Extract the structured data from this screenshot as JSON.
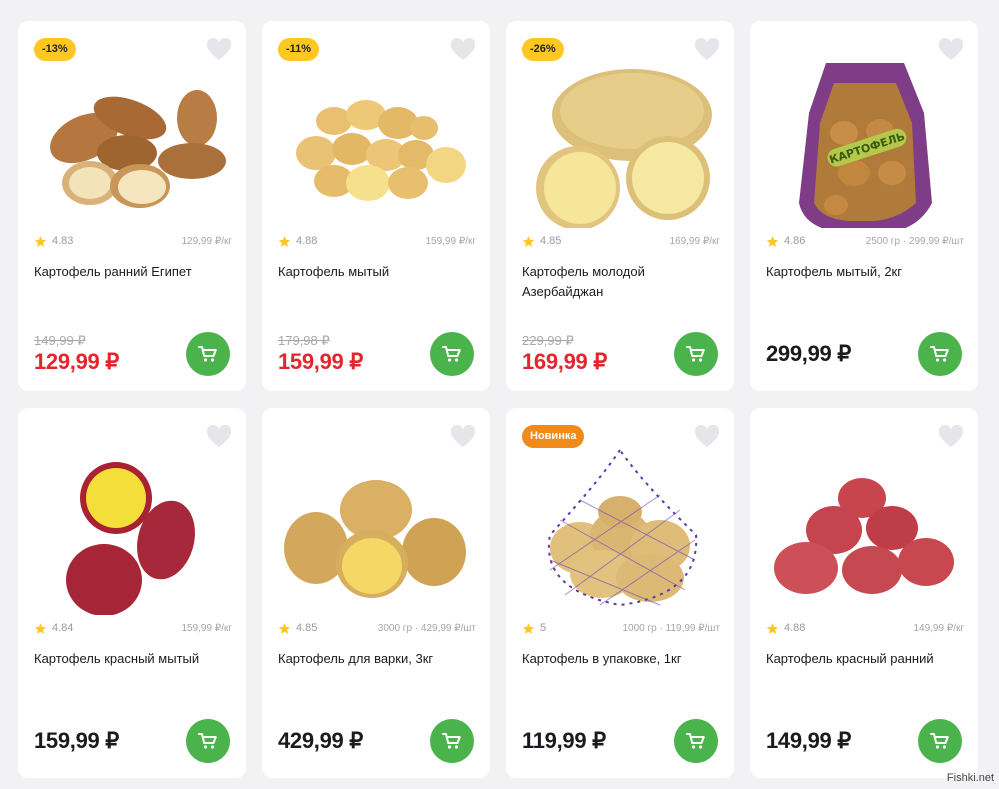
{
  "accent_color": "#4bb34b",
  "sale_color": "#e3262c",
  "badge_discount_color": "#ffc821",
  "badge_new_color": "#f08a1a",
  "products": [
    {
      "badge": "-13%",
      "badge_type": "discount",
      "rating": "4.83",
      "per_unit": "129,99 ₽/кг",
      "name": "Картофель ранний Египет",
      "old_price": "149,99 ₽",
      "price": "129,99 ₽",
      "image": "early-potatoes-egypt"
    },
    {
      "badge": "-11%",
      "badge_type": "discount",
      "rating": "4.88",
      "per_unit": "159,99 ₽/кг",
      "name": "Картофель мытый",
      "old_price": "179,98 ₽",
      "price": "159,99 ₽",
      "image": "washed-potatoes"
    },
    {
      "badge": "-26%",
      "badge_type": "discount",
      "rating": "4.85",
      "per_unit": "169,99 ₽/кг",
      "name": "Картофель молодой Азербайджан",
      "old_price": "229,99 ₽",
      "price": "169,99 ₽",
      "image": "young-potatoes"
    },
    {
      "badge": "",
      "badge_type": "",
      "rating": "4.86",
      "per_unit": "2500 гр · 299,99 ₽/шт",
      "name": "Картофель мытый, 2кг",
      "old_price": "",
      "price": "299,99 ₽",
      "image": "potato-bag-2kg",
      "bag_label": "КАРТОФЕЛЬ"
    },
    {
      "badge": "",
      "badge_type": "",
      "rating": "4.84",
      "per_unit": "159,99 ₽/кг",
      "name": "Картофель красный мытый",
      "old_price": "",
      "price": "159,99 ₽",
      "image": "red-washed-potatoes"
    },
    {
      "badge": "",
      "badge_type": "",
      "rating": "4.85",
      "per_unit": "3000 гр · 429,99 ₽/шт",
      "name": "Картофель для варки, 3кг",
      "old_price": "",
      "price": "429,99 ₽",
      "image": "boiling-potatoes"
    },
    {
      "badge": "Новинка",
      "badge_type": "new",
      "rating": "5",
      "per_unit": "1000 гр · 119,99 ₽/шт",
      "name": "Картофель в упаковке, 1кг",
      "old_price": "",
      "price": "119,99 ₽",
      "image": "potatoes-in-net"
    },
    {
      "badge": "",
      "badge_type": "",
      "rating": "4.88",
      "per_unit": "149,99 ₽/кг",
      "name": "Картофель красный ранний",
      "old_price": "",
      "price": "149,99 ₽",
      "image": "red-early-potatoes"
    }
  ],
  "icons": {
    "favorite": "heart-icon",
    "cart": "cart-icon",
    "rating": "star-icon"
  },
  "watermark": "Fishki.net"
}
